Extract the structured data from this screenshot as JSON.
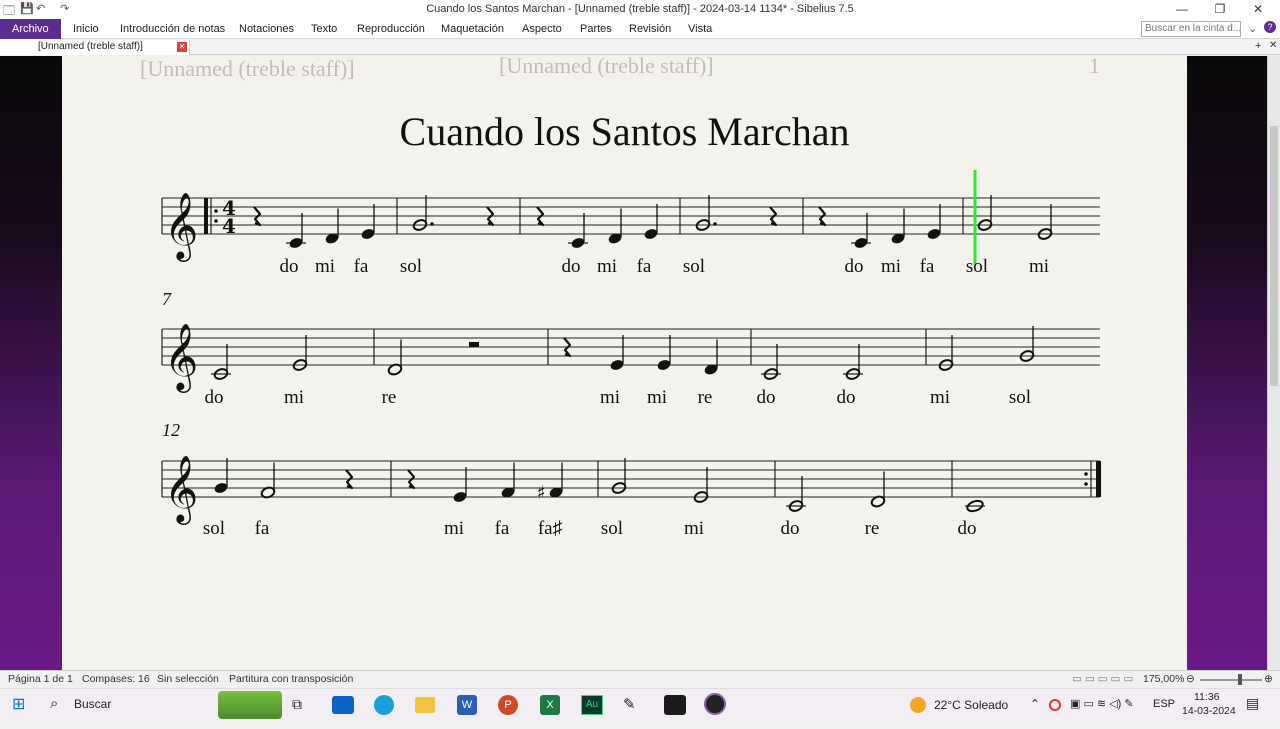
{
  "window": {
    "title": "Cuando los Santos Marchan - [Unnamed (treble staff)] - 2024-03-14 1134* - Sibelius 7.5"
  },
  "menu": [
    "Archivo",
    "Inicio",
    "Introducción de notas",
    "Notaciones",
    "Texto",
    "Reproducción",
    "Maquetación",
    "Aspecto",
    "Partes",
    "Revisión",
    "Vista"
  ],
  "search": {
    "placeholder": "Buscar en la cinta d..."
  },
  "doc_tab": {
    "label": "[Unnamed (treble staff)]"
  },
  "page_header": {
    "left": "[Unnamed (treble staff)]",
    "center": "[Unnamed (treble staff)]",
    "page_number": "1"
  },
  "score": {
    "title": "Cuando los Santos Marchan",
    "time_signature": "4/4",
    "system_numbers": [
      "7",
      "12"
    ],
    "lyrics": [
      [
        "do",
        "mi",
        "fa",
        "sol",
        "do",
        "mi",
        "fa",
        "sol",
        "do",
        "mi",
        "fa",
        "sol",
        "mi"
      ],
      [
        "do",
        "mi",
        "re",
        "mi",
        "mi",
        "re",
        "do",
        "do",
        "mi",
        "sol"
      ],
      [
        "sol",
        "fa",
        "mi",
        "fa",
        "fa♯",
        "sol",
        "mi",
        "do",
        "re",
        "do"
      ]
    ]
  },
  "status": {
    "page": "Página 1 de 1",
    "bars": "Compases: 16",
    "selection": "Sin selección",
    "transposition": "Partitura con transposición",
    "zoom": "175,00%"
  },
  "taskbar": {
    "search_label": "Buscar",
    "weather": "22°C Soleado",
    "lang": "ESP",
    "time": "11:36",
    "date": "14-03-2024"
  },
  "colors": {
    "accent": "#5c2d91",
    "playback_line": "#2ee82e"
  }
}
